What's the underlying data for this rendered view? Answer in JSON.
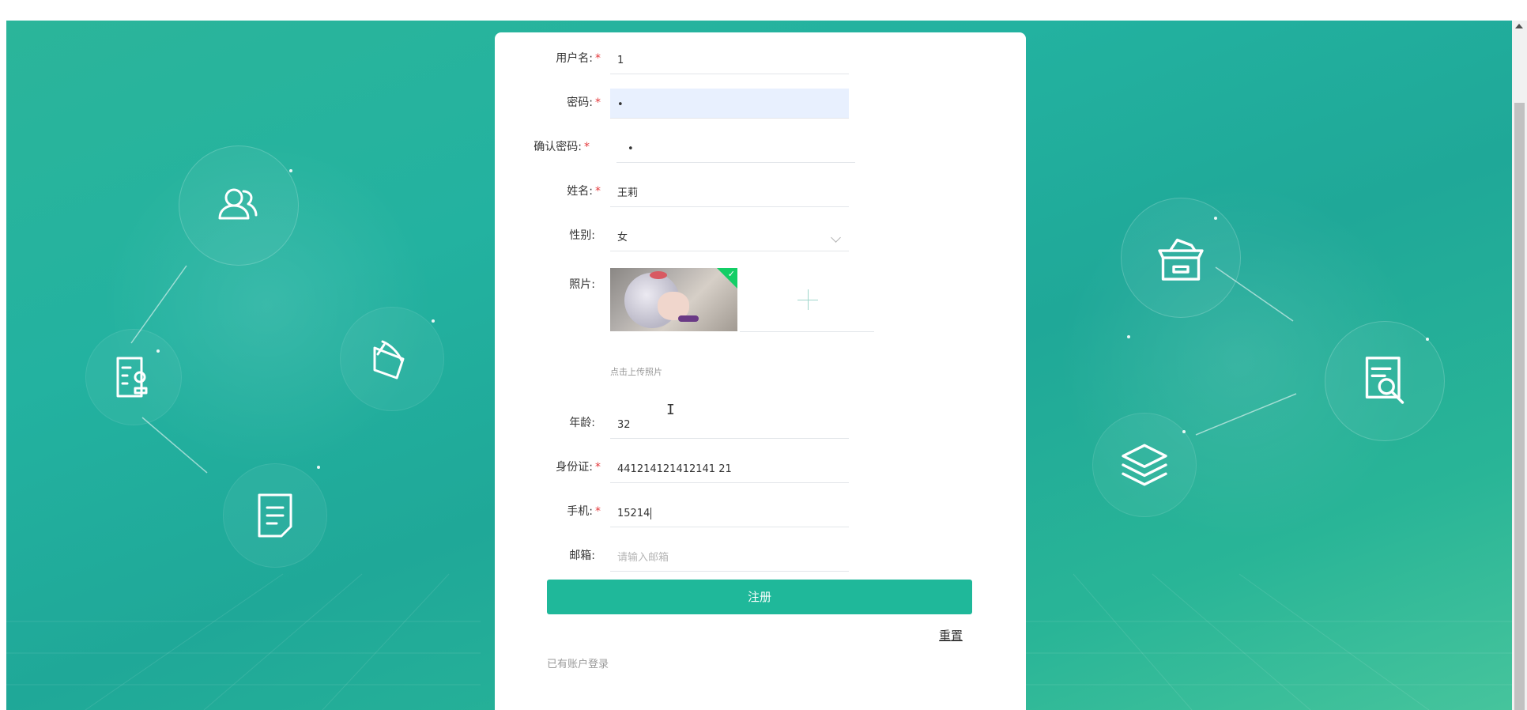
{
  "form": {
    "fields": [
      {
        "label": "用户名:",
        "required": true,
        "value": "1"
      },
      {
        "label": "密码:",
        "required": true,
        "value": "•"
      },
      {
        "label": "确认密码:",
        "required": true,
        "value": "•"
      },
      {
        "label": "姓名:",
        "required": true,
        "value": "王莉"
      },
      {
        "label": "性别:",
        "required": false,
        "value": "女"
      }
    ],
    "photo": {
      "label": "照片:",
      "hint": "点击上传照片"
    },
    "fields2": [
      {
        "label": "年龄:",
        "required": false,
        "value": "32"
      },
      {
        "label": "身份证:",
        "required": true,
        "value": "441214121412141 21"
      },
      {
        "label": "手机:",
        "required": true,
        "value": "15214"
      },
      {
        "label": "邮箱:",
        "required": false,
        "placeholder": "请输入邮箱"
      }
    ],
    "submit_label": "注册",
    "reset_label": "重置",
    "login_link": "已有账户登录",
    "required_mark": "*"
  },
  "colors": {
    "accent": "#1fb89a",
    "required": "#e4393c",
    "background": "#23b2a0"
  },
  "icons": [
    "users-icon",
    "stamp-document-icon",
    "pen-paper-icon",
    "note-icon",
    "archive-box-icon",
    "search-document-icon",
    "layers-icon"
  ]
}
